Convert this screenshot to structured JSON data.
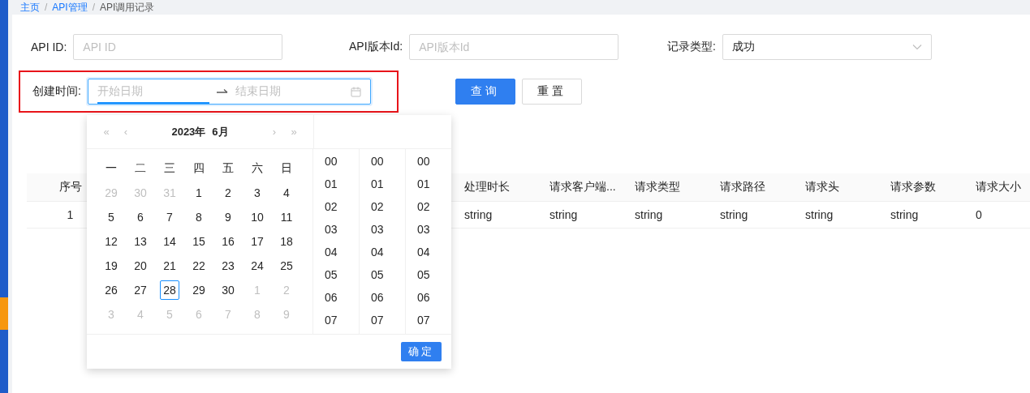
{
  "breadcrumb": [
    "主页",
    "API管理",
    "API调用记录"
  ],
  "breadcrumb_separator": "/",
  "filters": [
    {
      "kind": "input",
      "label": "API ID:",
      "placeholder": "API ID"
    },
    {
      "kind": "input",
      "label": "API版本Id:",
      "placeholder": "API版本Id"
    },
    {
      "kind": "select",
      "label": "记录类型:",
      "value": "成功"
    }
  ],
  "date_range": {
    "label": "创建时间:",
    "start_placeholder": "开始日期",
    "end_placeholder": "结束日期",
    "highlighted": true
  },
  "buttons": [
    {
      "kind": "primary",
      "label": "查询"
    },
    {
      "kind": "default",
      "label": "重置"
    }
  ],
  "table": {
    "columns": [
      "序号",
      "处理时长",
      "请求客户端...",
      "请求类型",
      "请求路径",
      "请求头",
      "请求参数",
      "请求大小"
    ],
    "rows": [
      [
        "1",
        "string",
        "string",
        "string",
        "string",
        "string",
        "string",
        "0"
      ]
    ]
  },
  "date_picker": {
    "year": "2023年",
    "month": "6月",
    "nav": [
      "«",
      "‹",
      "›",
      "»"
    ],
    "weekdays": [
      "一",
      "二",
      "三",
      "四",
      "五",
      "六",
      "日"
    ],
    "days": [
      {
        "label": "29",
        "in_month": false,
        "selected": false
      },
      {
        "label": "30",
        "in_month": false,
        "selected": false
      },
      {
        "label": "31",
        "in_month": false,
        "selected": false
      },
      {
        "label": "1",
        "in_month": true,
        "selected": false
      },
      {
        "label": "2",
        "in_month": true,
        "selected": false
      },
      {
        "label": "3",
        "in_month": true,
        "selected": false
      },
      {
        "label": "4",
        "in_month": true,
        "selected": false
      },
      {
        "label": "5",
        "in_month": true,
        "selected": false
      },
      {
        "label": "6",
        "in_month": true,
        "selected": false
      },
      {
        "label": "7",
        "in_month": true,
        "selected": false
      },
      {
        "label": "8",
        "in_month": true,
        "selected": false
      },
      {
        "label": "9",
        "in_month": true,
        "selected": false
      },
      {
        "label": "10",
        "in_month": true,
        "selected": false
      },
      {
        "label": "11",
        "in_month": true,
        "selected": false
      },
      {
        "label": "12",
        "in_month": true,
        "selected": false
      },
      {
        "label": "13",
        "in_month": true,
        "selected": false
      },
      {
        "label": "14",
        "in_month": true,
        "selected": false
      },
      {
        "label": "15",
        "in_month": true,
        "selected": false
      },
      {
        "label": "16",
        "in_month": true,
        "selected": false
      },
      {
        "label": "17",
        "in_month": true,
        "selected": false
      },
      {
        "label": "18",
        "in_month": true,
        "selected": false
      },
      {
        "label": "19",
        "in_month": true,
        "selected": false
      },
      {
        "label": "20",
        "in_month": true,
        "selected": false
      },
      {
        "label": "21",
        "in_month": true,
        "selected": false
      },
      {
        "label": "22",
        "in_month": true,
        "selected": false
      },
      {
        "label": "23",
        "in_month": true,
        "selected": false
      },
      {
        "label": "24",
        "in_month": true,
        "selected": false
      },
      {
        "label": "25",
        "in_month": true,
        "selected": false
      },
      {
        "label": "26",
        "in_month": true,
        "selected": false
      },
      {
        "label": "27",
        "in_month": true,
        "selected": false
      },
      {
        "label": "28",
        "in_month": true,
        "selected": true
      },
      {
        "label": "29",
        "in_month": true,
        "selected": false
      },
      {
        "label": "30",
        "in_month": true,
        "selected": false
      },
      {
        "label": "1",
        "in_month": false,
        "selected": false
      },
      {
        "label": "2",
        "in_month": false,
        "selected": false
      },
      {
        "label": "3",
        "in_month": false,
        "selected": false
      },
      {
        "label": "4",
        "in_month": false,
        "selected": false
      },
      {
        "label": "5",
        "in_month": false,
        "selected": false
      },
      {
        "label": "6",
        "in_month": false,
        "selected": false
      },
      {
        "label": "7",
        "in_month": false,
        "selected": false
      },
      {
        "label": "8",
        "in_month": false,
        "selected": false
      },
      {
        "label": "9",
        "in_month": false,
        "selected": false
      }
    ],
    "time_columns": [
      [
        "00",
        "01",
        "02",
        "03",
        "04",
        "05",
        "06",
        "07"
      ],
      [
        "00",
        "01",
        "02",
        "03",
        "04",
        "05",
        "06",
        "07"
      ],
      [
        "00",
        "01",
        "02",
        "03",
        "04",
        "05",
        "06",
        "07"
      ]
    ],
    "ok_button": "确定"
  }
}
